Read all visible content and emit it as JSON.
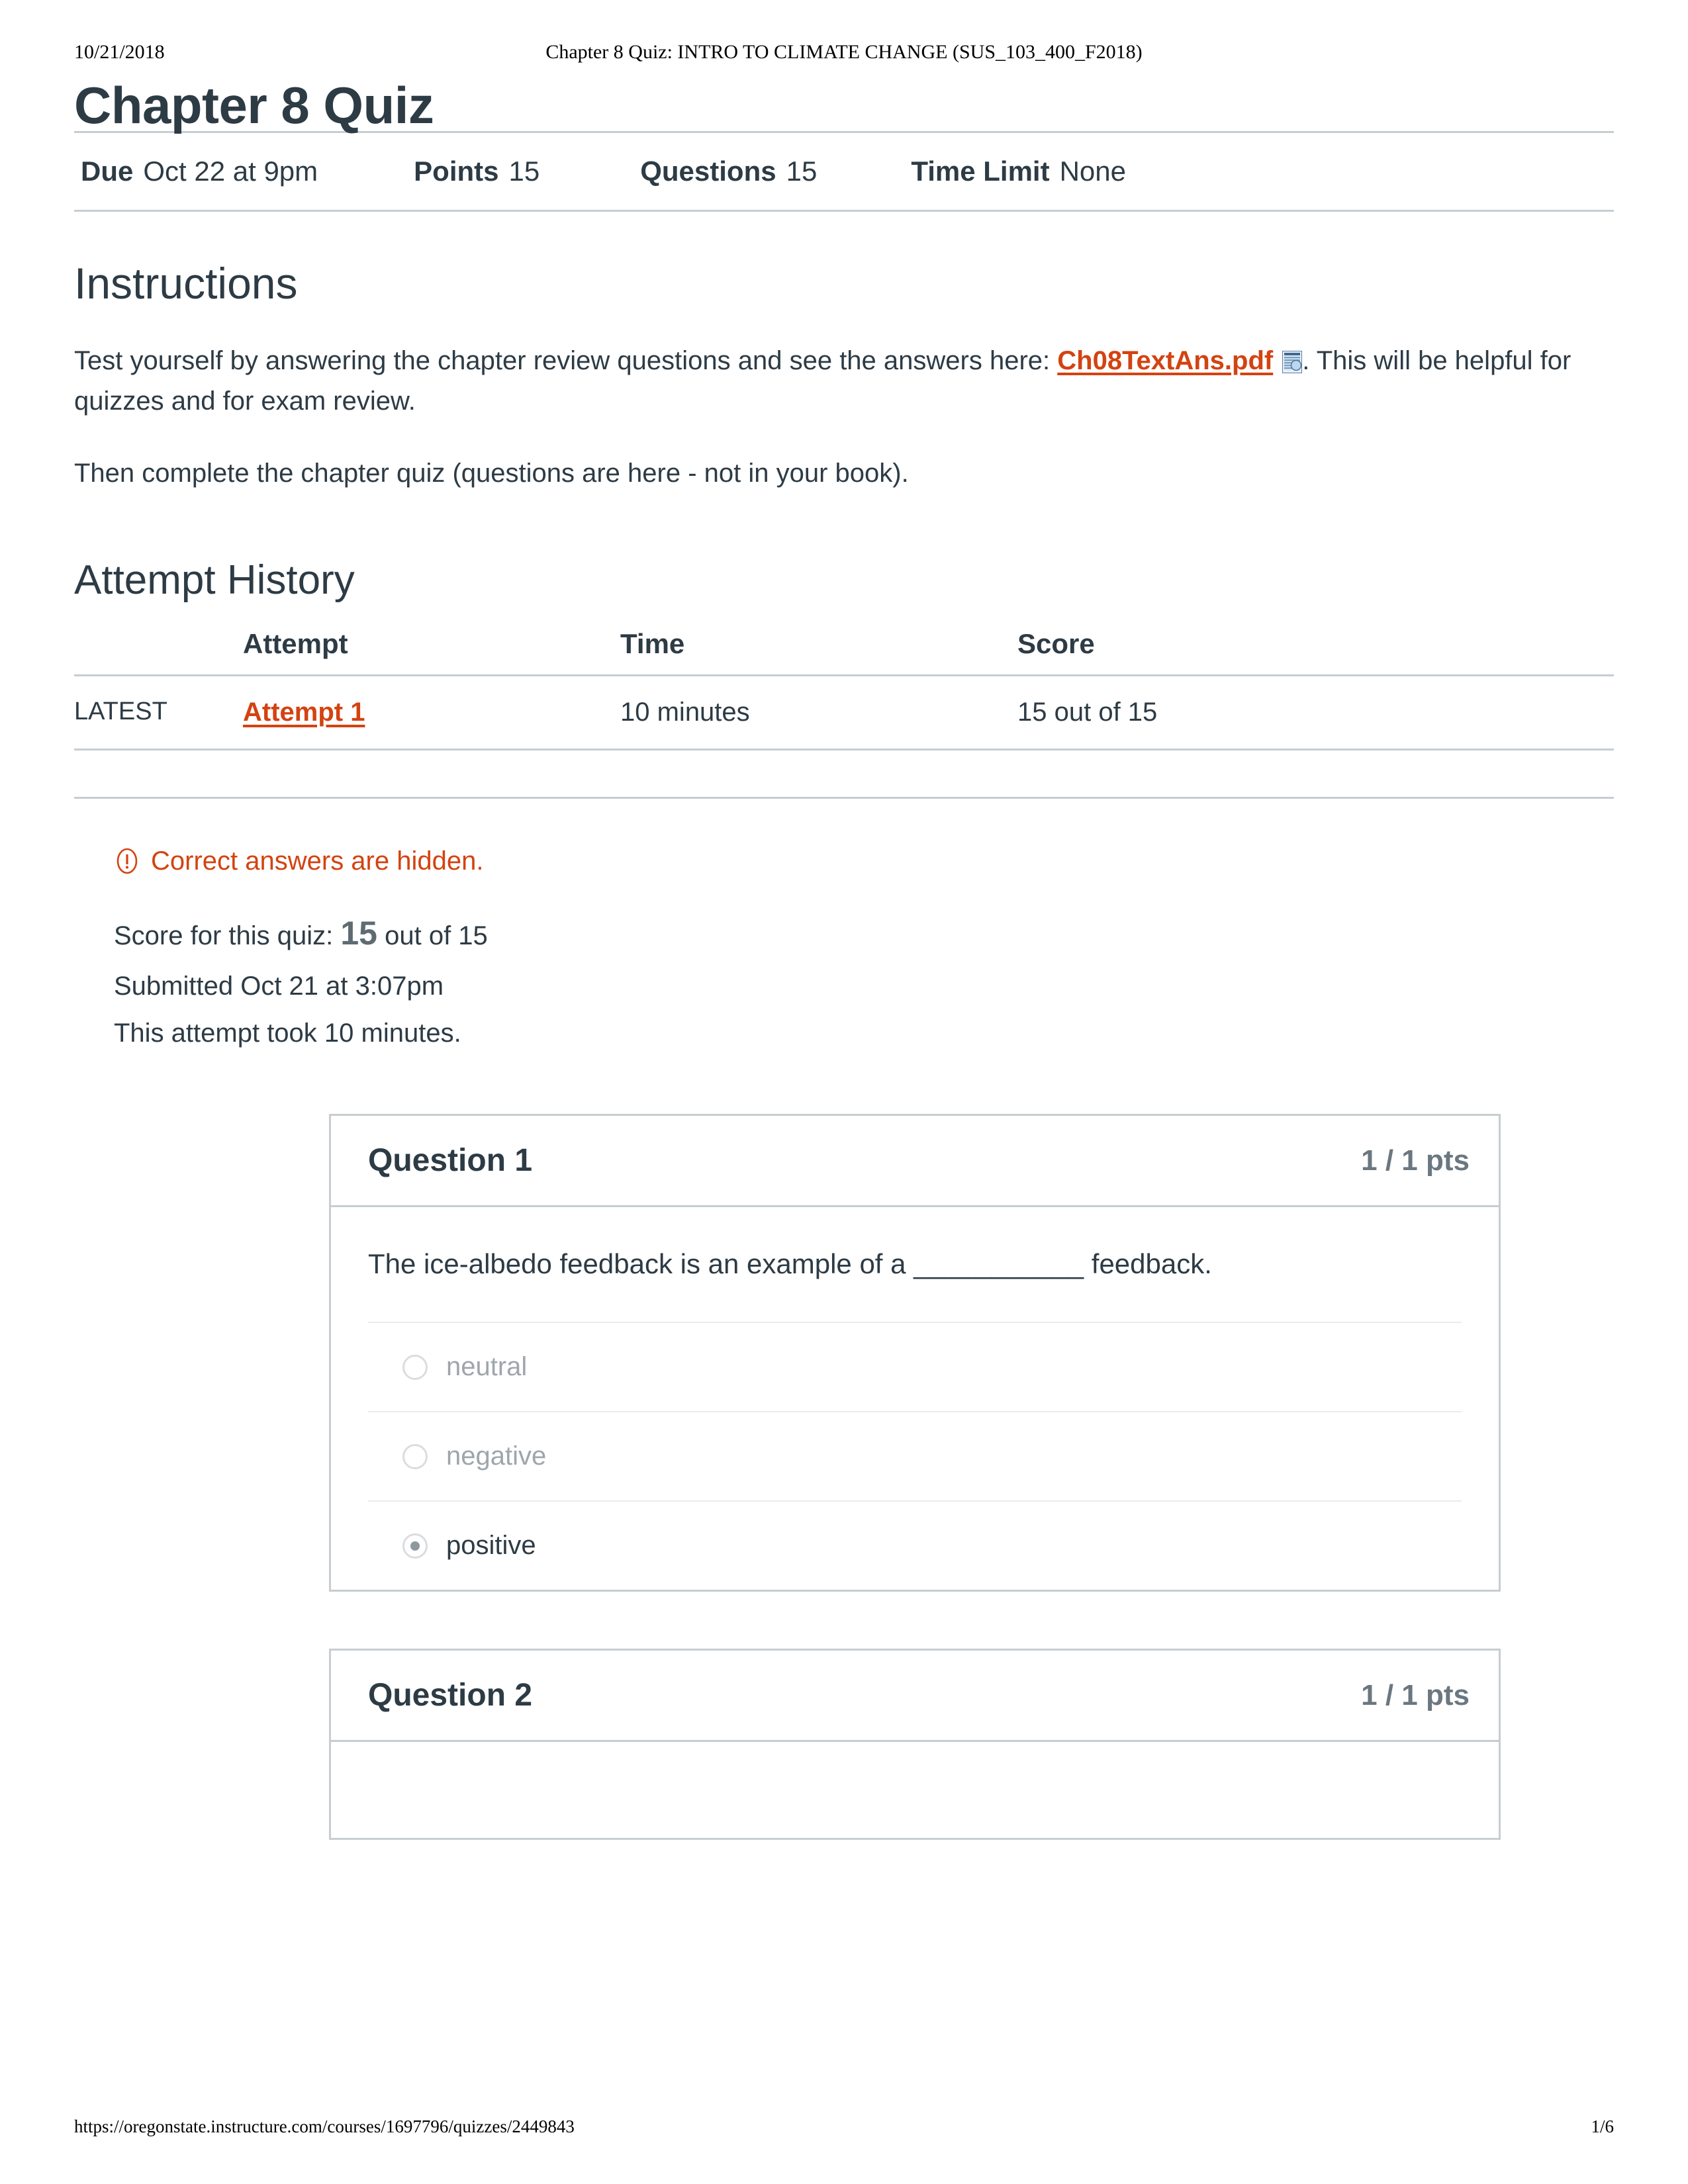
{
  "print": {
    "date": "10/21/2018",
    "doc_title": "Chapter 8 Quiz: INTRO TO CLIMATE CHANGE (SUS_103_400_F2018)",
    "url": "https://oregonstate.instructure.com/courses/1697796/quizzes/2449843",
    "page_number": "1/6"
  },
  "quiz": {
    "title": "Chapter 8 Quiz",
    "meta": {
      "due_label": "Due",
      "due_value": "Oct 22 at 9pm",
      "points_label": "Points",
      "points_value": "15",
      "questions_label": "Questions",
      "questions_value": "15",
      "time_limit_label": "Time Limit",
      "time_limit_value": "None"
    }
  },
  "instructions": {
    "heading": "Instructions",
    "line1_before_link": "Test yourself by answering the chapter review questions and see the answers here: ",
    "link_text": "Ch08TextAns.pdf",
    "link_icon": "document-preview-icon",
    "line1_after_link": ". This will be helpful for quizzes and for exam review.",
    "line2": "Then complete the chapter quiz (questions are here - not in your book)."
  },
  "attempt_history": {
    "heading": "Attempt History",
    "columns": [
      "",
      "Attempt",
      "Time",
      "Score"
    ],
    "rows": [
      {
        "kept": "LATEST",
        "attempt": "Attempt 1",
        "time": "10 minutes",
        "score": "15 out of 15"
      }
    ]
  },
  "result": {
    "warning_icon": "exclamation-circle-icon",
    "warning_text": "Correct answers are hidden.",
    "score_prefix": "Score for this quiz: ",
    "score_value": "15",
    "score_suffix": " out of 15",
    "submitted": "Submitted Oct 21 at 3:07pm",
    "duration": "This attempt took 10 minutes."
  },
  "questions": [
    {
      "name": "Question 1",
      "points": "1 / 1 pts",
      "text": "The ice-albedo feedback is an example of a ___________ feedback.",
      "answers": [
        {
          "label": "neutral",
          "selected": false
        },
        {
          "label": "negative",
          "selected": false
        },
        {
          "label": "positive",
          "selected": true
        }
      ]
    },
    {
      "name": "Question 2",
      "points": "1 / 1 pts",
      "text": "",
      "answers": []
    }
  ],
  "colors": {
    "link_orange": "#d34311",
    "text": "#2d3b45",
    "muted": "#9ea6ab",
    "rule": "#c7cdd1"
  }
}
